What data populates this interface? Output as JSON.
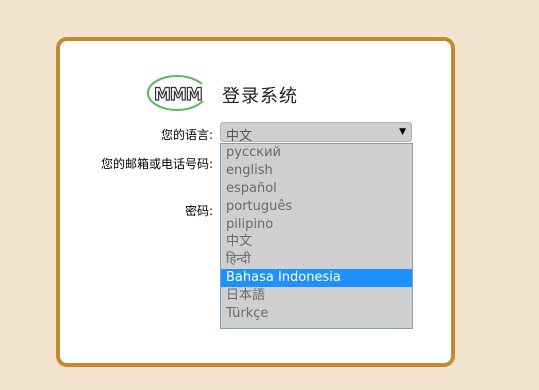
{
  "login": {
    "title": "登录系统",
    "language_label": "您的语言:",
    "account_label": "您的邮箱或电话号码:",
    "password_label": "密码:",
    "language_select": {
      "selected": "中文",
      "options": [
        "русский",
        "english",
        "español",
        "português",
        "pilipino",
        "中文",
        "हिन्दी",
        "Bahasa Indonesia",
        "日本語",
        "Türkçe"
      ],
      "highlighted_index": 7
    }
  },
  "colors": {
    "page_background": "#f2e4d0",
    "card_border": "#c8882e",
    "highlight": "#1e90ff",
    "logo_green": "#5cb85c"
  },
  "icons": [
    "mmm-logo",
    "chevron-down-icon"
  ]
}
